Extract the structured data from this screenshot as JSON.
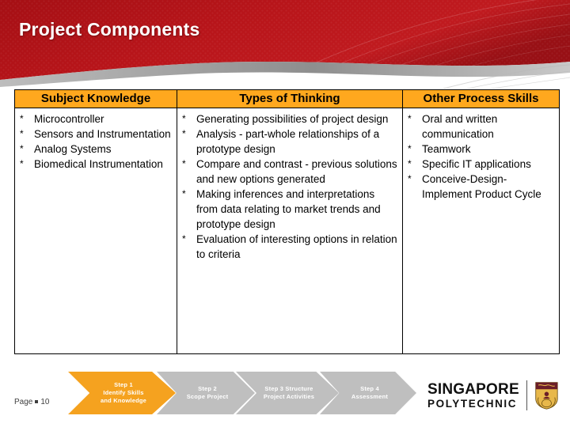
{
  "slide": {
    "title": "Project Components",
    "banner_color": "#B01217",
    "banner_color_dark": "#8E0D12",
    "swoosh_color": "#9A9A9A",
    "accent_orange": "#FFA81E"
  },
  "table": {
    "columns": [
      {
        "header": "Subject Knowledge",
        "bullets": [
          {
            "mark": "*",
            "text": "Microcontroller"
          },
          {
            "mark": "*",
            "text": "Sensors and Instrumentation"
          },
          {
            "mark": "*",
            "text": "Analog Systems"
          },
          {
            "mark": "*",
            "text": "Biomedical Instrumentation"
          }
        ]
      },
      {
        "header": "Types of Thinking",
        "bullets": [
          {
            "mark": "*",
            "text": "Generating possibilities of project design"
          },
          {
            "mark": "*",
            "text": "Analysis -  part-whole relationships of a prototype design"
          },
          {
            "mark": "*",
            "text": "Compare and contrast -  previous solutions and new options generated"
          },
          {
            "mark": "*",
            "text": "Making inferences and interpretations from data relating to market trends and prototype design"
          },
          {
            "mark": "*",
            "text": "Evaluation of interesting options in relation to criteria"
          }
        ]
      },
      {
        "header": "Other Process Skills",
        "bullets": [
          {
            "mark": "*",
            "text": "Oral and written communication"
          },
          {
            "mark": "*",
            "text": "Teamwork"
          },
          {
            "mark": "*",
            "text": "Specific IT applications"
          },
          {
            "mark": "*",
            "text": "Conceive-Design-Implement Product Cycle"
          }
        ]
      }
    ]
  },
  "process": {
    "steps": [
      {
        "line1": "Step 1",
        "line2": "Identify Skills",
        "line3": "and Knowledge",
        "state": "active",
        "color": "#F5A21F"
      },
      {
        "line1": "Step 2",
        "line2": "Scope Project",
        "line3": "",
        "state": "inactive",
        "color": "#BFBFBF"
      },
      {
        "line1": "Step 3 Structure",
        "line2": "Project Activities",
        "line3": "",
        "state": "inactive",
        "color": "#BFBFBF"
      },
      {
        "line1": "Step 4",
        "line2": "Assessment",
        "line3": "",
        "state": "inactive",
        "color": "#BFBFBF"
      }
    ]
  },
  "footer": {
    "page_label": "Page",
    "page_number": "10"
  },
  "logo": {
    "line1": "SINGAPORE",
    "line2": "POLYTECHNIC",
    "crest_band_color": "#6B1E28",
    "crest_body_color": "#E8B84B"
  }
}
